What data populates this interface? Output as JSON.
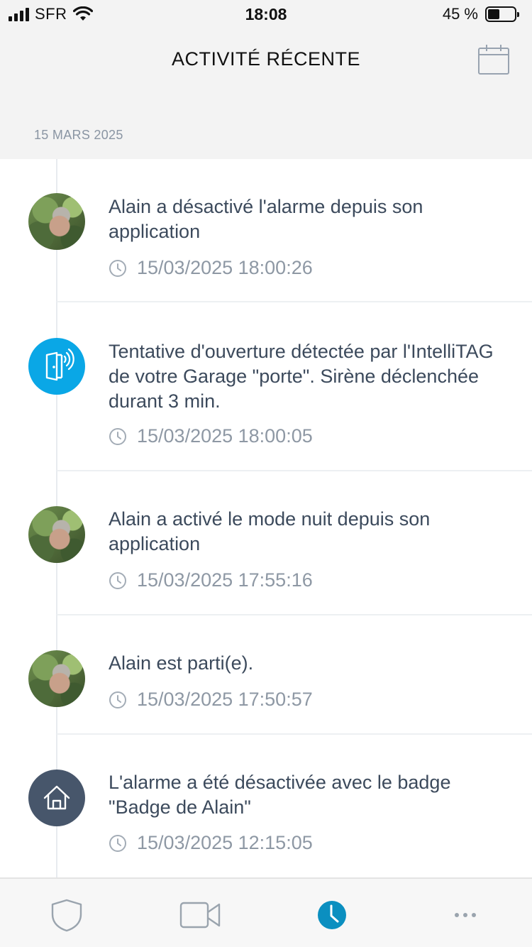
{
  "status_bar": {
    "carrier": "SFR",
    "time": "18:08",
    "battery_text": "45 %",
    "battery_level": 0.45
  },
  "header": {
    "title": "ACTIVITÉ RÉCENTE",
    "calendar_icon": "calendar-icon"
  },
  "date_group": "15 MARS 2025",
  "events": [
    {
      "icon": "user-avatar",
      "text": "Alain a désactivé l'alarme depuis son application",
      "timestamp": "15/03/2025 18:00:26"
    },
    {
      "icon": "door-sensor-icon",
      "text": "Tentative d'ouverture détectée par l'IntelliTAG de votre Garage \"porte\". Sirène déclenchée durant 3 min.",
      "timestamp": "15/03/2025 18:00:05"
    },
    {
      "icon": "user-avatar",
      "text": "Alain a activé le mode nuit depuis son application",
      "timestamp": "15/03/2025 17:55:16"
    },
    {
      "icon": "user-avatar",
      "text": "Alain est parti(e).",
      "timestamp": "15/03/2025 17:50:57"
    },
    {
      "icon": "home-icon",
      "text": "L'alarme a été désactivée avec le badge \"Badge de Alain\"",
      "timestamp": "15/03/2025 12:15:05"
    }
  ],
  "tab_bar": {
    "tabs": [
      "shield-icon",
      "video-camera-icon",
      "clock-icon",
      "more-icon"
    ],
    "active_tab": "clock-icon",
    "active_color": "#0b8fc0"
  }
}
